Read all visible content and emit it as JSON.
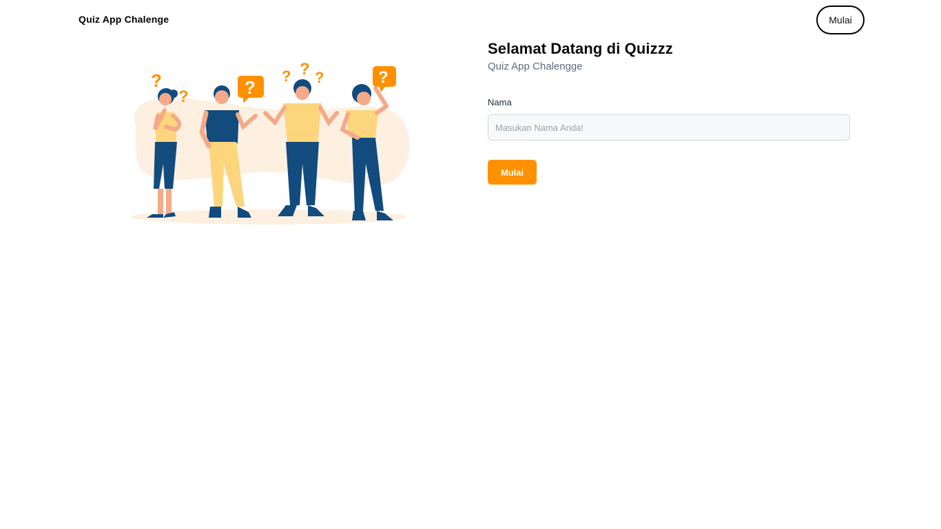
{
  "header": {
    "brand": "Quiz App Chalenge",
    "nav_button_label": "Mulai"
  },
  "hero": {
    "title": "Selamat Datang di Quizzz",
    "subtitle": "Quiz App Chalengge"
  },
  "form": {
    "name_label": "Nama",
    "name_placeholder": "Masukan Nama Anda!",
    "name_value": "",
    "submit_label": "Mulai"
  },
  "illustration": {
    "subject": "four confused people with question marks",
    "question_mark": "?",
    "colors": {
      "accent": "#ff9100",
      "navy": "#124b7d",
      "shirt_yellow": "#fcd57c",
      "blob": "#fdf0e1",
      "skin": "#f5a989"
    }
  },
  "colors": {
    "primary_button": "#ff9100",
    "text_dark": "#0b0b0b",
    "text_muted": "#5f6b7a",
    "input_bg": "#f8f9fb",
    "input_border": "#d1d5db"
  }
}
